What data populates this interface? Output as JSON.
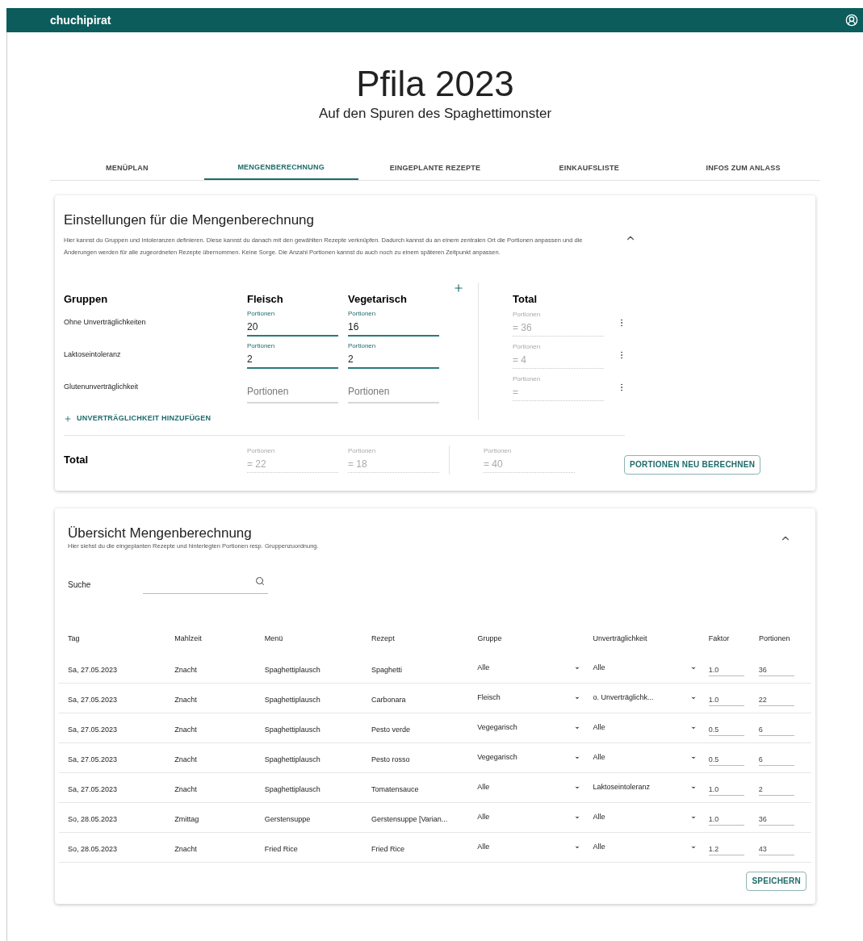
{
  "app_bar": {
    "title": "chuchipirat"
  },
  "event": {
    "title": "Pfila 2023",
    "subtitle": "Auf den Spuren des Spaghettimonster"
  },
  "tabs": [
    {
      "label": "MENÜPLAN",
      "selected": false
    },
    {
      "label": "MENGENBERECHNUNG",
      "selected": true
    },
    {
      "label": "EINGEPLANTE REZEPTE",
      "selected": false
    },
    {
      "label": "EINKAUFSLISTE",
      "selected": false
    },
    {
      "label": "INFOS ZUM ANLASS",
      "selected": false
    }
  ],
  "settings": {
    "title": "Einstellungen für die Mengenberechnung",
    "expanded": true,
    "description": "Hier kannst du Gruppen und Intoleranzen definieren. Diese kannst du danach mit den gewählten Rezepte verknüpfen. Dadurch kannst du an einem zentralen Ort die Portionen anpassen und die Änderungen werden für alle zugeordneten Rezepte übernommen. Keine Sorge. Die Anzahl Portionen kannst du auch noch zu einem späteren Zeitpunkt anpassen.",
    "groups_header": "Gruppen",
    "columns": [
      "Fleisch",
      "Vegetarisch"
    ],
    "total_header": "Total",
    "rows": [
      {
        "label": "Ohne Unverträglichkeiten",
        "fields": [
          {
            "label": "Portionen",
            "value": "20"
          },
          {
            "label": "Portionen",
            "value": "16"
          }
        ],
        "total": {
          "label": "Portionen",
          "value": "= 36"
        }
      },
      {
        "label": "Laktoseintoleranz",
        "fields": [
          {
            "label": "Portionen",
            "value": "2"
          },
          {
            "label": "Portionen",
            "value": "2"
          }
        ],
        "total": {
          "label": "Portionen",
          "value": "= 4"
        }
      },
      {
        "label": "Glutenunverträglichkeit",
        "fields": [
          {
            "placeholder": "Portionen"
          },
          {
            "placeholder": "Portionen"
          }
        ],
        "total": {
          "label": "Portionen",
          "value": "="
        }
      }
    ],
    "add_intolerance": "UNVERTRÄGLICHKEIT HINZUFÜGEN",
    "total_row": {
      "label": "Total",
      "fields": [
        {
          "label": "Portionen",
          "value": "= 22"
        },
        {
          "label": "Portionen",
          "value": "= 18"
        }
      ],
      "total": {
        "label": "Portionen",
        "value": "= 40"
      }
    },
    "recalc_button": "PORTIONEN NEU BERECHNEN"
  },
  "overview": {
    "title": "Übersicht Mengenberechnung",
    "expanded": true,
    "description": "Hier siehst du die eingeplanten Rezepte und hinterlegten Portionen resp. Gruppenzuordnung.",
    "search": {
      "label": "Suche"
    },
    "columns": [
      "Tag",
      "Mahlzeit",
      "Menü",
      "Rezept",
      "Gruppe",
      "Unverträglichkeit",
      "Faktor",
      "Portionen"
    ],
    "rows": [
      {
        "day": "Sa, 27.05.2023",
        "meal": "Znacht",
        "menu": "Spaghettiplausch",
        "recipe": "Spaghetti",
        "group": "Alle",
        "intolerance": "Alle",
        "factor": "1.0",
        "portions": "36"
      },
      {
        "day": "Sa, 27.05.2023",
        "meal": "Znacht",
        "menu": "Spaghettiplausch",
        "recipe": "Carbonara",
        "group": "Fleisch",
        "intolerance": "o. Unverträglichk...",
        "factor": "1.0",
        "portions": "22"
      },
      {
        "day": "Sa, 27.05.2023",
        "meal": "Znacht",
        "menu": "Spaghettiplausch",
        "recipe": "Pesto verde",
        "group": "Vegegarisch",
        "intolerance": "Alle",
        "factor": "0.5",
        "portions": "6"
      },
      {
        "day": "Sa, 27.05.2023",
        "meal": "Znacht",
        "menu": "Spaghettiplausch",
        "recipe": "Pesto rosso",
        "group": "Vegegarisch",
        "intolerance": "Alle",
        "factor": "0.5",
        "portions": "6"
      },
      {
        "day": "Sa, 27.05.2023",
        "meal": "Znacht",
        "menu": "Spaghettiplausch",
        "recipe": "Tomatensauce",
        "group": "Alle",
        "intolerance": "Laktoseintoleranz",
        "factor": "1.0",
        "portions": "2"
      },
      {
        "day": "So, 28.05.2023",
        "meal": "Zmittag",
        "menu": "Gerstensuppe",
        "recipe": "Gerstensuppe [Varian...",
        "group": "Alle",
        "intolerance": "Alle",
        "factor": "1.0",
        "portions": "36"
      },
      {
        "day": "So, 28.05.2023",
        "meal": "Znacht",
        "menu": "Fried Rice",
        "recipe": "Fried Rice",
        "group": "Alle",
        "intolerance": "Alle",
        "factor": "1.2",
        "portions": "43"
      }
    ],
    "save_button": "SPEICHERN"
  }
}
